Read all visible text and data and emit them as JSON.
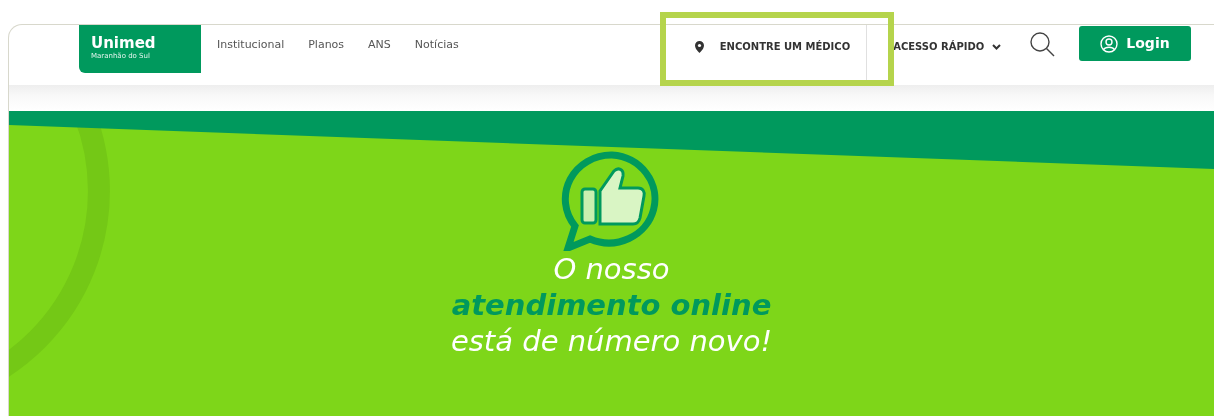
{
  "header": {
    "logo": {
      "name": "Unimed",
      "subtitle": "Maranhão do Sul"
    },
    "nav": [
      {
        "label": "Institucional"
      },
      {
        "label": "Planos"
      },
      {
        "label": "ANS"
      },
      {
        "label": "Notícias"
      }
    ],
    "find_doctor": {
      "label": "ENCONTRE UM MÉDICO",
      "highlighted": true
    },
    "quick_access": {
      "label": "ACESSO RÁPIDO"
    },
    "login": {
      "label": "Login"
    }
  },
  "banner": {
    "headline": [
      {
        "text": "O nosso",
        "kind": "plain"
      },
      {
        "text": "atendimento online",
        "kind": "emphasis"
      },
      {
        "text": "está de número novo!",
        "kind": "plain"
      }
    ]
  }
}
